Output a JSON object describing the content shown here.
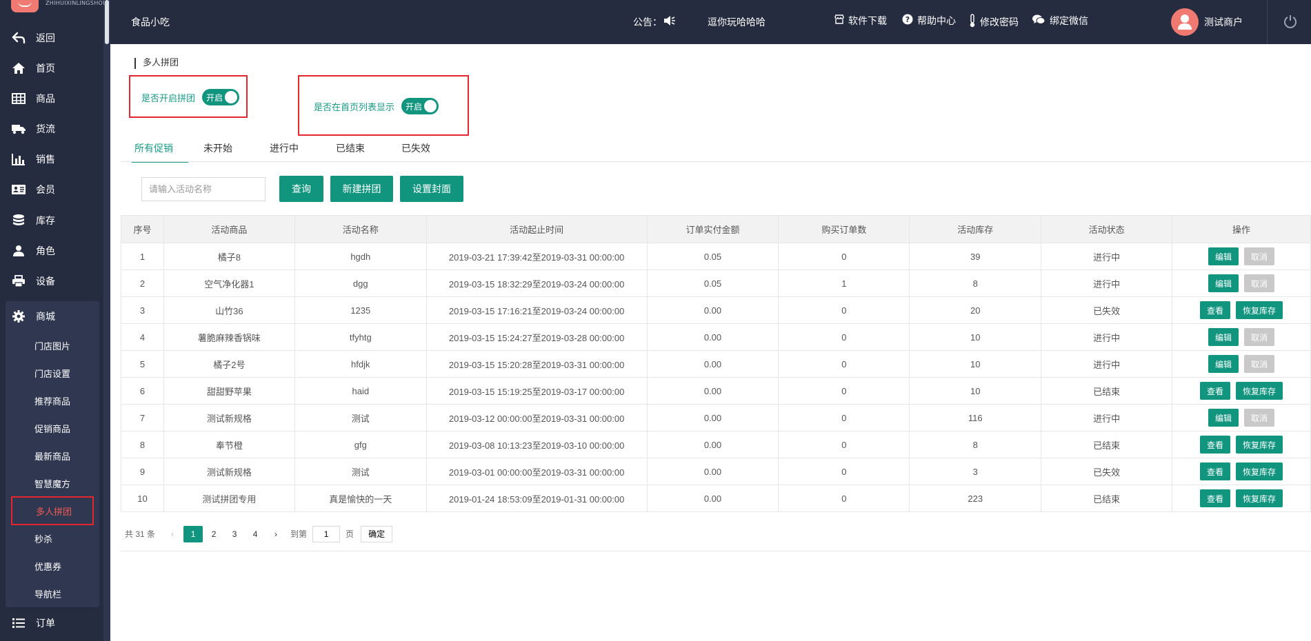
{
  "logo": {
    "text": "ZHIHUIXINLINGSHOU"
  },
  "sidebar": {
    "items": [
      {
        "label": "返回",
        "icon": "back-arrow-icon"
      },
      {
        "label": "首页",
        "icon": "home-icon"
      },
      {
        "label": "商品",
        "icon": "grid-table-icon"
      },
      {
        "label": "货流",
        "icon": "truck-icon"
      },
      {
        "label": "销售",
        "icon": "bar-chart-icon"
      },
      {
        "label": "会员",
        "icon": "id-card-icon"
      },
      {
        "label": "库存",
        "icon": "database-icon"
      },
      {
        "label": "角色",
        "icon": "user-icon"
      },
      {
        "label": "设备",
        "icon": "printer-icon"
      },
      {
        "label": "商城",
        "icon": "gear-icon"
      },
      {
        "label": "订单",
        "icon": "list-icon"
      }
    ],
    "submenu": [
      {
        "label": "门店图片"
      },
      {
        "label": "门店设置"
      },
      {
        "label": "推荐商品"
      },
      {
        "label": "促销商品"
      },
      {
        "label": "最新商品"
      },
      {
        "label": "智慧魔方"
      },
      {
        "label": "多人拼团"
      },
      {
        "label": "秒杀"
      },
      {
        "label": "优惠券"
      },
      {
        "label": "导航栏"
      }
    ]
  },
  "header": {
    "store_name": "食品小吃",
    "notice_label": "公告：",
    "notice_text": "逗你玩哈哈哈",
    "tools": [
      {
        "label": "软件下载",
        "icon": "store-icon"
      },
      {
        "label": "帮助中心",
        "icon": "help-icon"
      },
      {
        "label": "修改密码",
        "icon": "thermometer-icon"
      },
      {
        "label": "绑定微信",
        "icon": "wechat-icon"
      }
    ],
    "user_name": "测试商户"
  },
  "page": {
    "title": "多人拼团",
    "toggle_enable": {
      "label": "是否开启拼团",
      "state": "开启"
    },
    "toggle_home": {
      "label": "是否在首页列表显示",
      "state": "开启"
    },
    "tabs": [
      "所有促销",
      "未开始",
      "进行中",
      "已结束",
      "已失效"
    ],
    "search_placeholder": "请输入活动名称",
    "buttons": {
      "query": "查询",
      "new": "新建拼团",
      "cover": "设置封面"
    }
  },
  "table": {
    "headers": [
      "序号",
      "活动商品",
      "活动名称",
      "活动起止时间",
      "订单实付金额",
      "购买订单数",
      "活动库存",
      "活动状态",
      "操作"
    ],
    "rows": [
      {
        "no": "1",
        "product": "橘子8",
        "name": "hgdh",
        "time": "2019-03-21 17:39:42至2019-03-31 00:00:00",
        "amount": "0.05",
        "orders": "0",
        "stock": "39",
        "status": "进行中",
        "actions": [
          "编辑",
          "取消"
        ]
      },
      {
        "no": "2",
        "product": "空气净化器1",
        "name": "dgg",
        "time": "2019-03-15 18:32:29至2019-03-24 00:00:00",
        "amount": "0.05",
        "orders": "1",
        "stock": "8",
        "status": "进行中",
        "actions": [
          "编辑",
          "取消"
        ]
      },
      {
        "no": "3",
        "product": "山竹36",
        "name": "1235",
        "time": "2019-03-15 17:16:21至2019-03-24 00:00:00",
        "amount": "0.00",
        "orders": "0",
        "stock": "20",
        "status": "已失效",
        "actions": [
          "查看",
          "恢复库存"
        ]
      },
      {
        "no": "4",
        "product": "薯脆麻辣香锅味",
        "name": "tfyhtg",
        "time": "2019-03-15 15:24:27至2019-03-28 00:00:00",
        "amount": "0.00",
        "orders": "0",
        "stock": "10",
        "status": "进行中",
        "actions": [
          "编辑",
          "取消"
        ]
      },
      {
        "no": "5",
        "product": "橘子2号",
        "name": "hfdjk",
        "time": "2019-03-15 15:20:28至2019-03-31 00:00:00",
        "amount": "0.00",
        "orders": "0",
        "stock": "10",
        "status": "进行中",
        "actions": [
          "编辑",
          "取消"
        ]
      },
      {
        "no": "6",
        "product": "甜甜野苹果",
        "name": "haid",
        "time": "2019-03-15 15:19:25至2019-03-17 00:00:00",
        "amount": "0.00",
        "orders": "0",
        "stock": "10",
        "status": "已结束",
        "actions": [
          "查看",
          "恢复库存"
        ]
      },
      {
        "no": "7",
        "product": "测试新规格",
        "name": "测试",
        "time": "2019-03-12 00:00:00至2019-03-31 00:00:00",
        "amount": "0.00",
        "orders": "0",
        "stock": "116",
        "status": "进行中",
        "actions": [
          "编辑",
          "取消"
        ]
      },
      {
        "no": "8",
        "product": "奉节橙",
        "name": "gfg",
        "time": "2019-03-08 10:13:23至2019-03-10 00:00:00",
        "amount": "0.00",
        "orders": "0",
        "stock": "8",
        "status": "已结束",
        "actions": [
          "查看",
          "恢复库存"
        ]
      },
      {
        "no": "9",
        "product": "测试新规格",
        "name": "测试",
        "time": "2019-03-01 00:00:00至2019-03-31 00:00:00",
        "amount": "0.00",
        "orders": "0",
        "stock": "3",
        "status": "已失效",
        "actions": [
          "查看",
          "恢复库存"
        ]
      },
      {
        "no": "10",
        "product": "测试拼团专用",
        "name": "真是愉快的一天",
        "time": "2019-01-24 18:53:09至2019-01-31 00:00:00",
        "amount": "0.00",
        "orders": "0",
        "stock": "223",
        "status": "已结束",
        "actions": [
          "查看",
          "恢复库存"
        ]
      }
    ]
  },
  "pagination": {
    "total_text": "共 31 条",
    "pages": [
      "1",
      "2",
      "3",
      "4"
    ],
    "current": "1",
    "goto_label": "到第",
    "goto_value": "1",
    "page_unit": "页",
    "confirm": "确定"
  },
  "colors": {
    "accent": "#11957f",
    "sidebar": "#252c3f",
    "highlight": "#e5262e"
  }
}
